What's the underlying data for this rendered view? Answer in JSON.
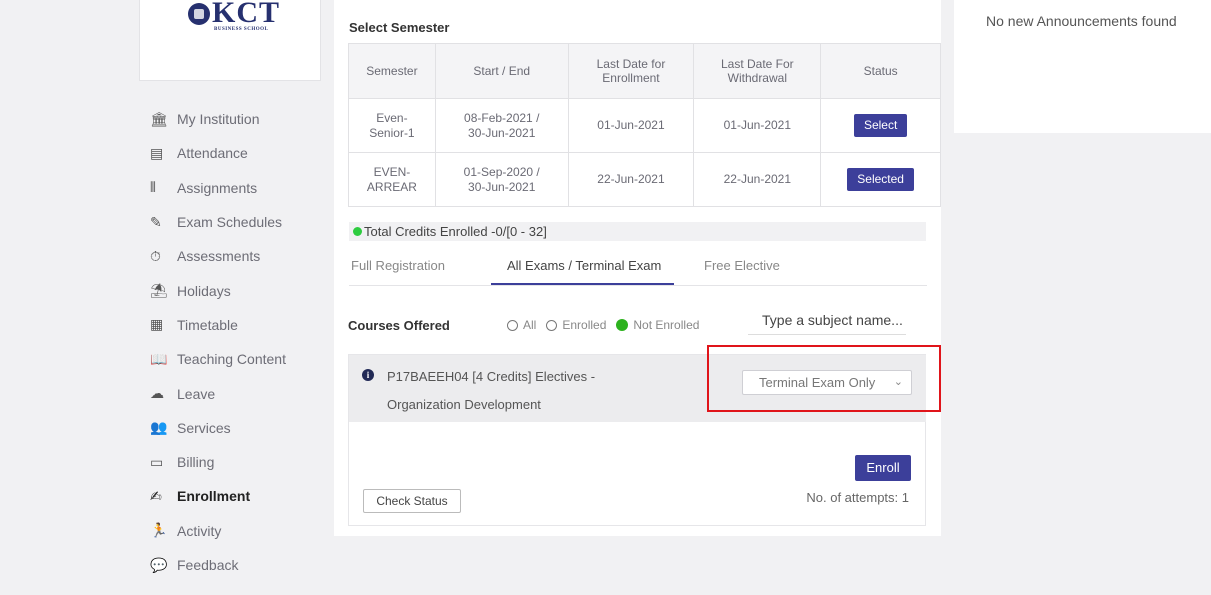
{
  "logo": {
    "text": "KCT",
    "subtext": "BUSINESS SCHOOL"
  },
  "sidebar": {
    "items": [
      {
        "label": "My Institution",
        "icon": "institution-icon",
        "glyph": "🏛"
      },
      {
        "label": "Attendance",
        "icon": "attendance-icon",
        "glyph": "▤"
      },
      {
        "label": "Assignments",
        "icon": "assignments-icon",
        "glyph": "⫴"
      },
      {
        "label": "Exam Schedules",
        "icon": "exam-schedules-icon",
        "glyph": "✎"
      },
      {
        "label": "Assessments",
        "icon": "stopwatch-icon",
        "glyph": "⏱"
      },
      {
        "label": "Holidays",
        "icon": "umbrella-icon",
        "glyph": "⛱"
      },
      {
        "label": "Timetable",
        "icon": "calendar-icon",
        "glyph": "▦"
      },
      {
        "label": "Teaching Content",
        "icon": "book-icon",
        "glyph": "📖"
      },
      {
        "label": "Leave",
        "icon": "leave-icon",
        "glyph": "☁"
      },
      {
        "label": "Services",
        "icon": "users-icon",
        "glyph": "👥"
      },
      {
        "label": "Billing",
        "icon": "billing-icon",
        "glyph": "▭"
      },
      {
        "label": "Enrollment",
        "icon": "edit-icon",
        "glyph": "✍"
      },
      {
        "label": "Activity",
        "icon": "running-icon",
        "glyph": "🏃"
      },
      {
        "label": "Feedback",
        "icon": "feedback-icon",
        "glyph": "💬"
      }
    ],
    "active": "Enrollment"
  },
  "semester": {
    "title": "Select Semester",
    "headers": [
      "Semester",
      "Start / End",
      "Last Date for Enrollment",
      "Last Date For Withdrawal",
      "Status"
    ],
    "rows": [
      {
        "semester": "Even-Senior-1",
        "start_end": "08-Feb-2021 / 30-Jun-2021",
        "enroll": "01-Jun-2021",
        "withdraw": "01-Jun-2021",
        "status": "Select"
      },
      {
        "semester": "EVEN-ARREAR",
        "start_end": "01-Sep-2020 / 30-Jun-2021",
        "enroll": "22-Jun-2021",
        "withdraw": "22-Jun-2021",
        "status": "Selected"
      }
    ]
  },
  "credits": {
    "text": "Total Credits Enrolled -0/[0 - 32]"
  },
  "tabs": [
    {
      "label": "Full Registration"
    },
    {
      "label": "All Exams / Terminal Exam"
    },
    {
      "label": "Free Elective"
    }
  ],
  "courses": {
    "label": "Courses Offered",
    "filters": [
      "All",
      "Enrolled",
      "Not Enrolled"
    ],
    "selected_filter": "Not Enrolled",
    "search_placeholder": "Type a subject name...",
    "item": {
      "title": "P17BAEEH04 [4 Credits] Electives -",
      "subtitle": "Organization Development",
      "exam_option": "Terminal Exam Only"
    },
    "enroll_label": "Enroll",
    "attempts": "No. of attempts: 1",
    "check_status_label": "Check Status"
  },
  "announcements": {
    "text": "No new Announcements found"
  },
  "colors": {
    "accent": "#3c3f9a",
    "highlight": "#e0141a",
    "green": "#2ecc40"
  }
}
